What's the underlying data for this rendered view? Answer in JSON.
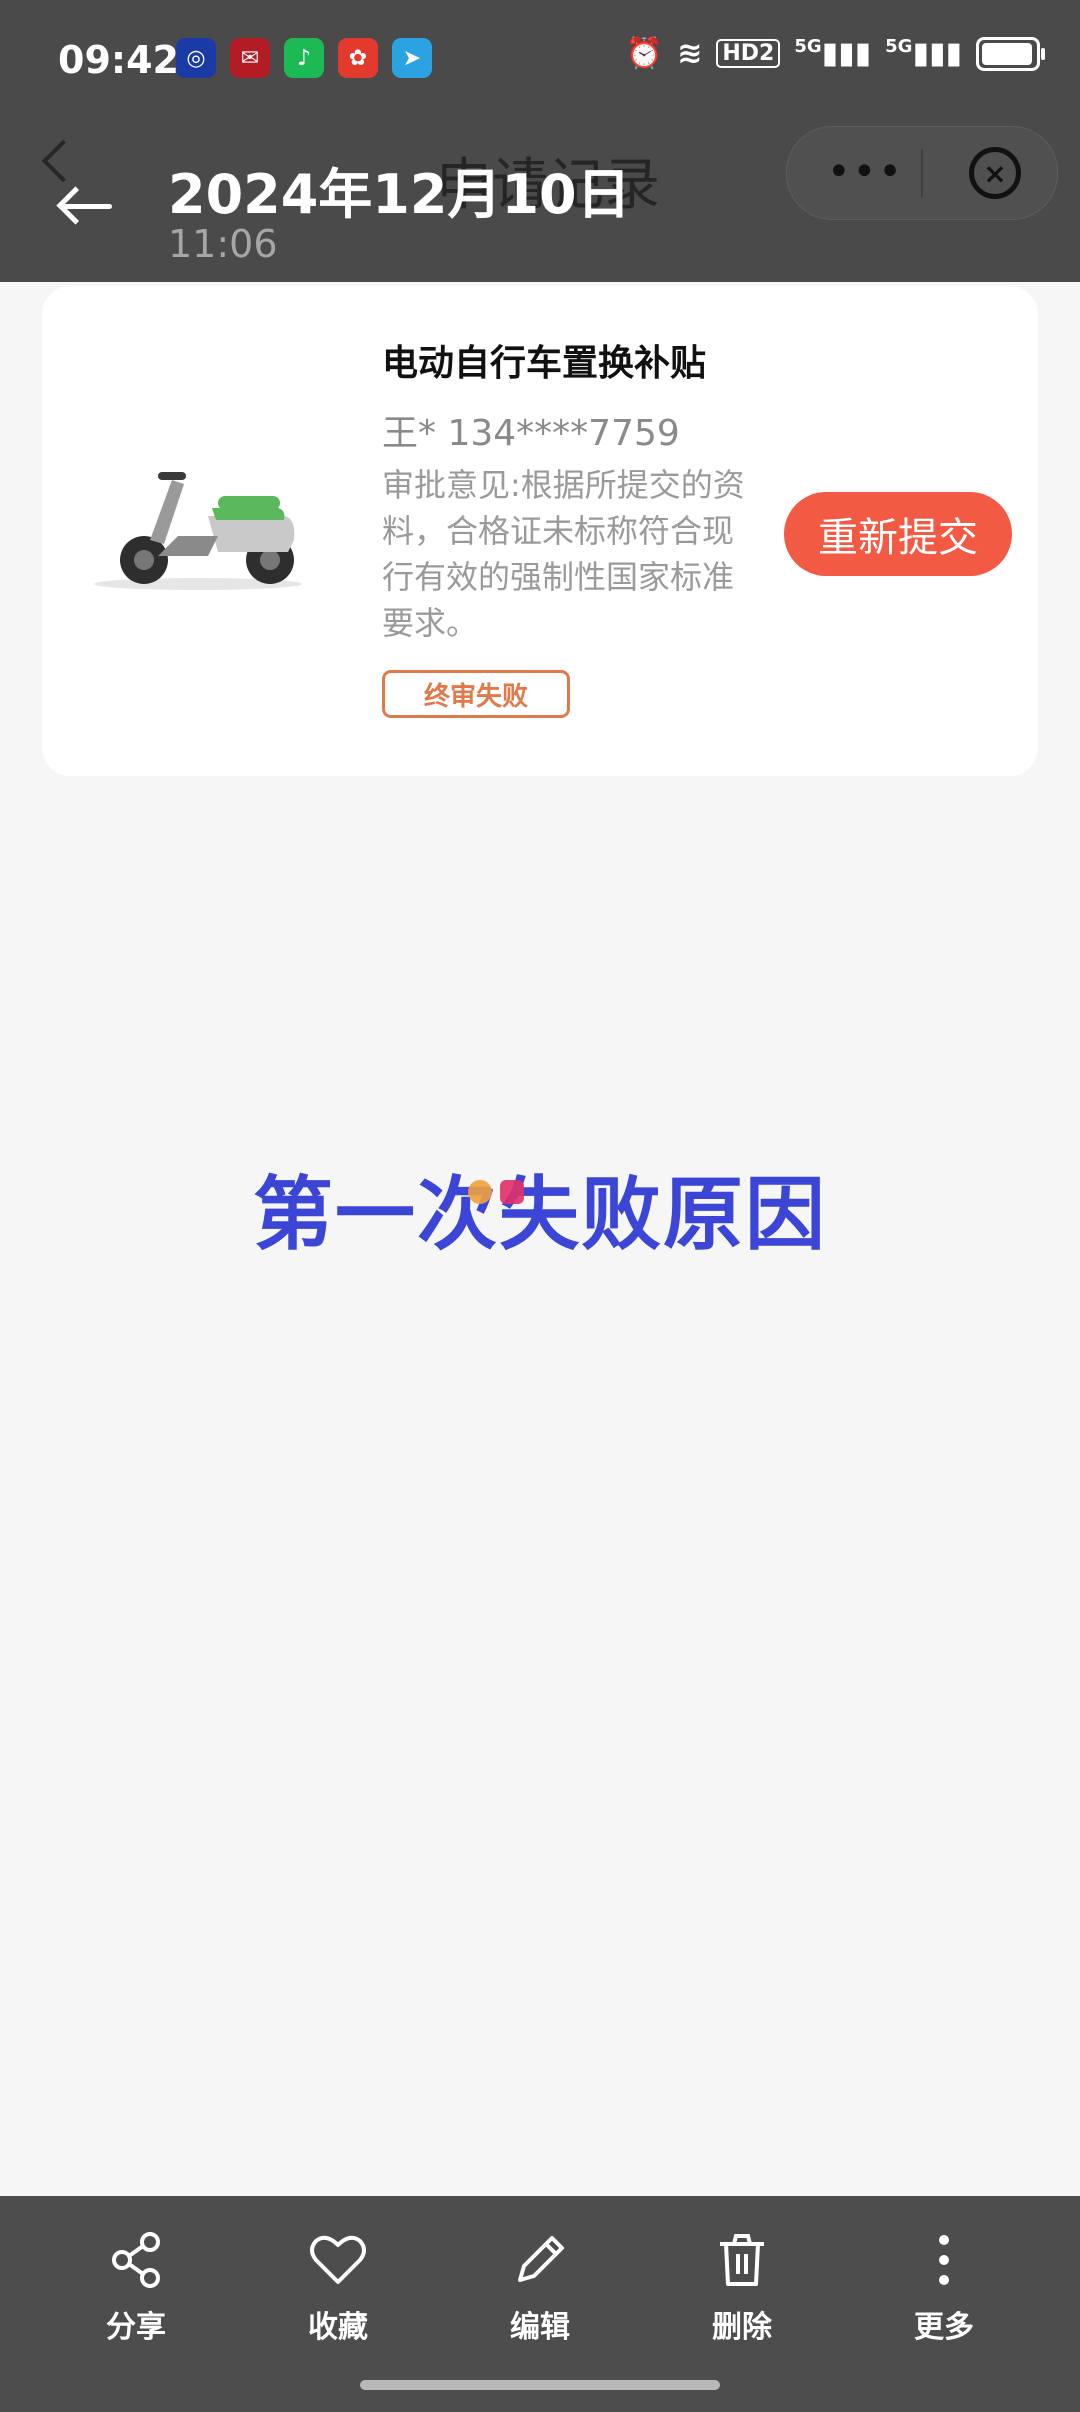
{
  "status_bar": {
    "time": "09:42",
    "apps": [
      {
        "name": "baidu-app-icon",
        "glyph": "◎",
        "color": "#1a3aa6"
      },
      {
        "name": "wechat-app-icon",
        "glyph": "✉",
        "color": "#b31b25"
      },
      {
        "name": "spotify-app-icon",
        "glyph": "♪",
        "color": "#1db954"
      },
      {
        "name": "game-app-icon",
        "glyph": "✿",
        "color": "#e23b2e"
      },
      {
        "name": "telegram-app-icon",
        "glyph": "➤",
        "color": "#2aa3e0"
      }
    ],
    "net_labels": [
      "HD2",
      "5G",
      "5G"
    ]
  },
  "page": {
    "title": "申请记录"
  },
  "viewer": {
    "date": "2024年12月10日",
    "time": "11:06"
  },
  "card": {
    "title": "电动自行车置换补贴",
    "user": "王* 134****7759",
    "note": "审批意见:根据所提交的资料，合格证未标称符合现行有效的强制性国家标准要求。",
    "status": "终审失败",
    "status_color": "#e07a4a",
    "action": "重新提交",
    "action_color": "#f25a43"
  },
  "caption": "第一次失败原因",
  "toolbar": {
    "items": [
      {
        "label": "分享",
        "icon": "share-icon"
      },
      {
        "label": "收藏",
        "icon": "heart-icon"
      },
      {
        "label": "编辑",
        "icon": "pencil-icon"
      },
      {
        "label": "删除",
        "icon": "trash-icon"
      },
      {
        "label": "更多",
        "icon": "more-vertical-icon"
      }
    ]
  }
}
